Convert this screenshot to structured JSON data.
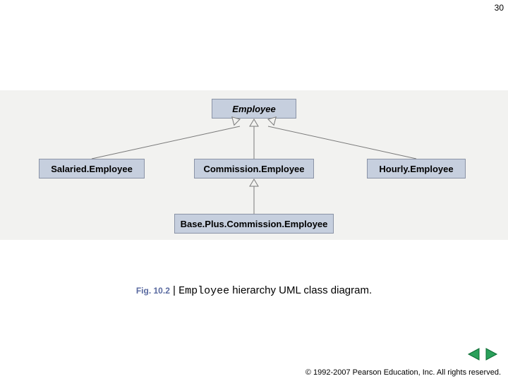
{
  "page_number": "30",
  "diagram": {
    "parent": "Employee",
    "children": [
      "Salaried.Employee",
      "Commission.Employee",
      "Hourly.Employee"
    ],
    "grandchild": "Base.Plus.Commission.Employee"
  },
  "caption": {
    "fig_label": "Fig. 10.2",
    "sep": " | ",
    "code_word": "Employee",
    "rest": " hierarchy UML class diagram."
  },
  "copyright": "© 1992-2007 Pearson Education, Inc.  All rights reserved.",
  "nav": {
    "prev_icon": "prev",
    "next_icon": "next"
  }
}
